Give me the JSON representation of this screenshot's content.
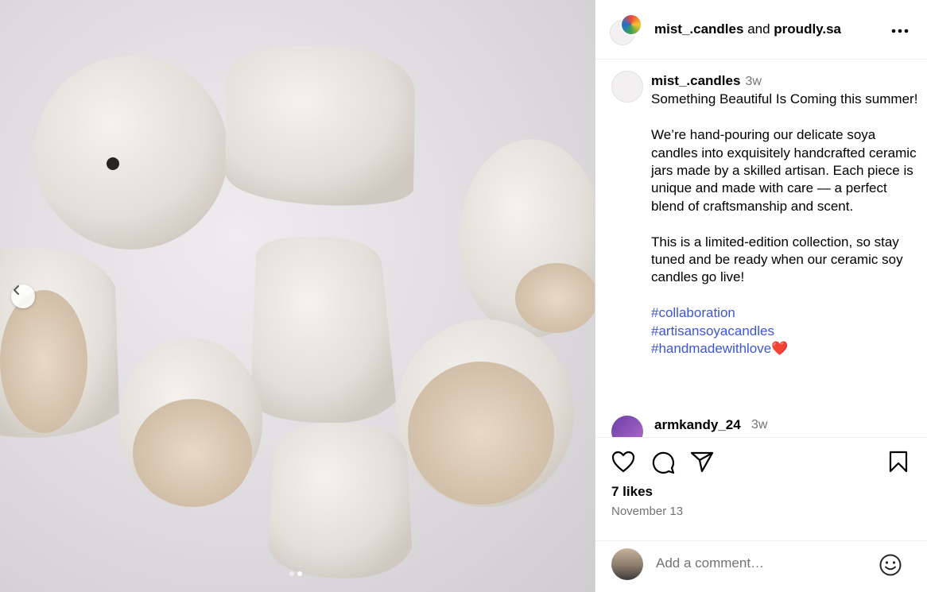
{
  "post": {
    "media": {
      "slide_count": 2,
      "active_slide": 2
    },
    "header": {
      "author": "mist_.candles",
      "connector": "and",
      "collaborator": "proudly.sa"
    },
    "caption": {
      "username": "mist_.candles",
      "time": "3w",
      "paragraphs": [
        "Something Beautiful Is Coming this summer!",
        "We’re hand-pouring our delicate soya candles into exquisitely handcrafted ceramic jars made by a skilled artisan. Each piece is unique and made with care — a perfect blend of craftsmanship and scent.",
        "This is a limited-edition collection, so stay tuned and be ready when our ceramic soy candles go live!"
      ],
      "hashtags": [
        "#collaboration",
        "#artisansoyacandles",
        "#handmadewithlove"
      ],
      "hashtag_emoji": "❤️"
    },
    "first_comment": {
      "username": "armkandy_24",
      "time": "3w"
    },
    "likes": "7 likes",
    "date": "November 13",
    "comment_box": {
      "placeholder": "Add a comment…"
    }
  },
  "icons": {
    "more": "more-horizontal-icon",
    "like": "heart-icon",
    "comment": "comment-bubble-icon",
    "share": "paper-plane-icon",
    "save": "bookmark-icon",
    "emoji": "smiley-icon",
    "prev": "chevron-left-icon"
  },
  "colors": {
    "hashtag": "#3c56d6",
    "secondary_text": "#737373",
    "divider": "#efefef"
  }
}
